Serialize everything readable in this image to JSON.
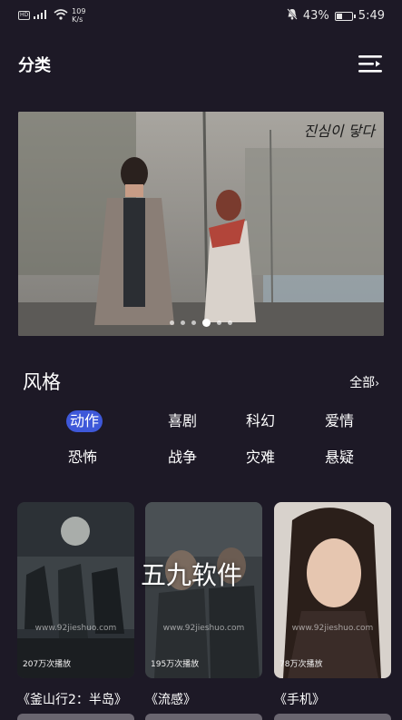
{
  "status_bar": {
    "hd": "HD",
    "signal": "⁴⁶",
    "net_speed_value": "109",
    "net_speed_unit": "K/s",
    "battery": "43%",
    "battery_level": 0.43,
    "time": "5:49"
  },
  "header": {
    "title": "分类"
  },
  "banner": {
    "caption": "진심이 닿다",
    "slide_count": 6,
    "active_slide": 3
  },
  "style_section": {
    "title": "风格",
    "all_label": "全部",
    "genres": [
      "动作",
      "喜剧",
      "科幻",
      "爱情",
      "恐怖",
      "战争",
      "灾难",
      "悬疑"
    ],
    "active_genre": "动作"
  },
  "posters": [
    {
      "views": "207万次播放",
      "title": "《釜山行2：半岛》",
      "site": "www.92jieshuo.com"
    },
    {
      "views": "195万次播放",
      "title": "《流感》",
      "site": "www.92jieshuo.com"
    },
    {
      "views": "78万次播放",
      "title": "《手机》",
      "site": "www.92jieshuo.com"
    }
  ],
  "overlay_watermark": "五九软件",
  "colors": {
    "background": "#1d1926",
    "accent": "#3e58d9"
  }
}
